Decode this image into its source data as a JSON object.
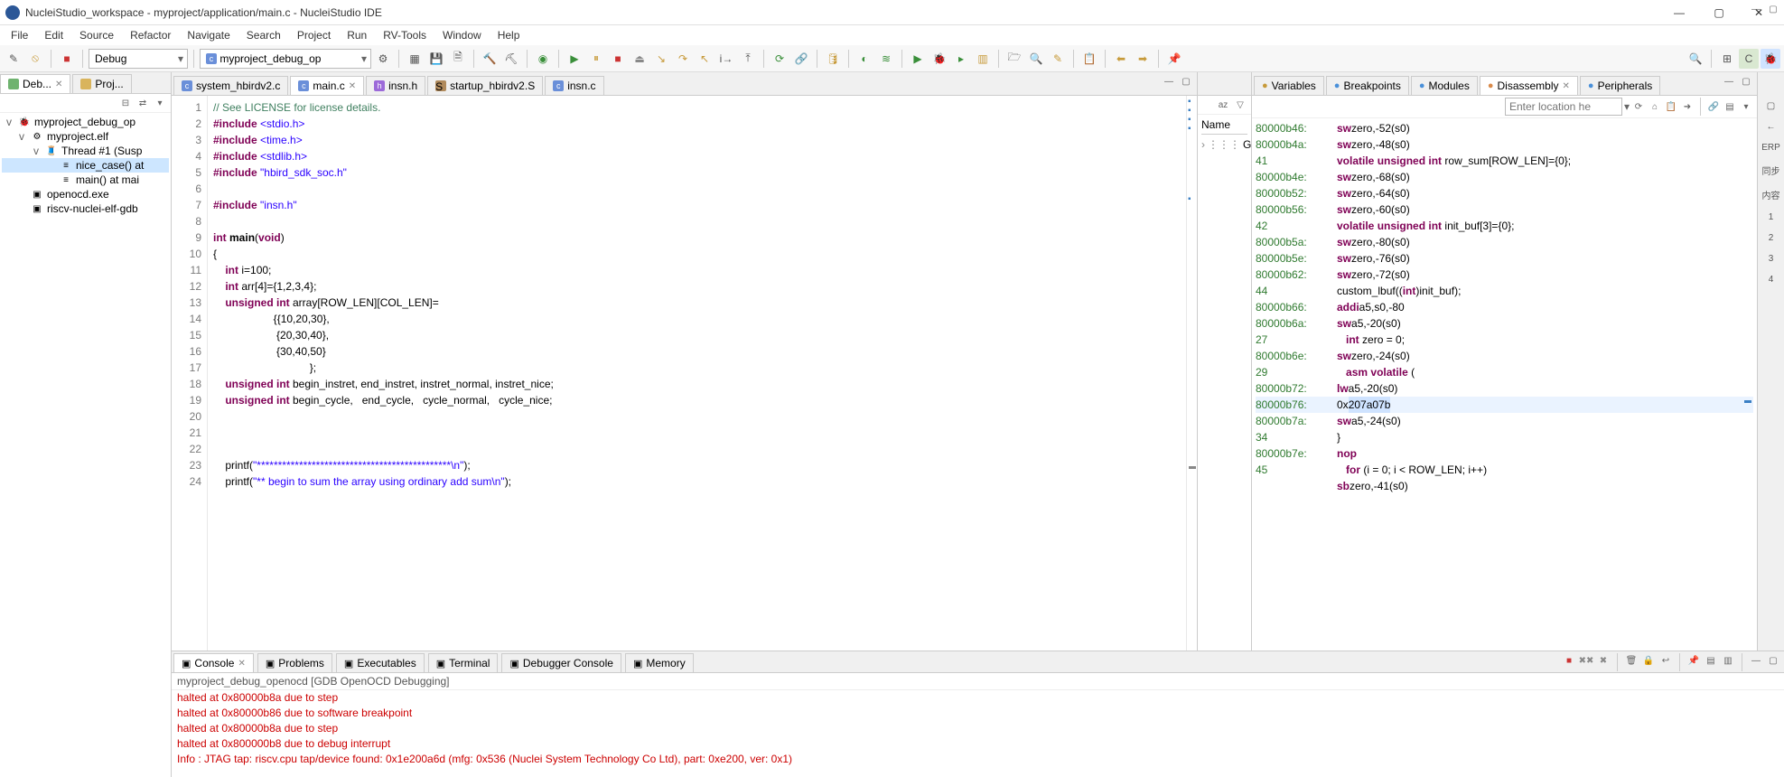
{
  "title": "NucleiStudio_workspace - myproject/application/main.c - NucleiStudio IDE",
  "menus": [
    "File",
    "Edit",
    "Source",
    "Refactor",
    "Navigate",
    "Search",
    "Project",
    "Run",
    "RV-Tools",
    "Window",
    "Help"
  ],
  "toolbar": {
    "config": "Debug",
    "launch": "myproject_debug_op"
  },
  "left": {
    "tabs": [
      {
        "label": "Deb...",
        "active": true
      },
      {
        "label": "Proj...",
        "active": false
      }
    ],
    "tree": [
      {
        "label": "myproject_debug_op",
        "depth": 0,
        "exp": "v",
        "icon": "🐞"
      },
      {
        "label": "myproject.elf",
        "depth": 1,
        "exp": "v",
        "icon": "⚙"
      },
      {
        "label": "Thread #1 (Susp",
        "depth": 2,
        "exp": "v",
        "icon": "🧵"
      },
      {
        "label": "nice_case() at",
        "depth": 3,
        "icon": "≡",
        "sel": true
      },
      {
        "label": "main() at mai",
        "depth": 3,
        "icon": "≡"
      },
      {
        "label": "openocd.exe",
        "depth": 1,
        "icon": "▣"
      },
      {
        "label": "riscv-nuclei-elf-gdb",
        "depth": 1,
        "icon": "▣"
      }
    ]
  },
  "editor": {
    "tabs": [
      {
        "label": "system_hbirdv2.c",
        "type": "c"
      },
      {
        "label": "main.c",
        "type": "c",
        "active": true
      },
      {
        "label": "insn.h",
        "type": "h"
      },
      {
        "label": "startup_hbirdv2.S",
        "type": "s"
      },
      {
        "label": "insn.c",
        "type": "c"
      }
    ],
    "lines": [
      {
        "n": 1,
        "html": "<span class='c-comment'>// See LICENSE for license details.</span>"
      },
      {
        "n": 2,
        "html": "<span class='c-pp'>#include</span> <span class='c-ppinc'>&lt;stdio.h&gt;</span>"
      },
      {
        "n": 3,
        "html": "<span class='c-pp'>#include</span> <span class='c-ppinc'>&lt;time.h&gt;</span>"
      },
      {
        "n": 4,
        "html": "<span class='c-pp'>#include</span> <span class='c-ppinc'>&lt;stdlib.h&gt;</span>"
      },
      {
        "n": 5,
        "html": "<span class='c-pp'>#include</span> <span class='c-ppinc'>\"hbird_sdk_soc.h\"</span>"
      },
      {
        "n": 6,
        "html": ""
      },
      {
        "n": 7,
        "html": "<span class='c-pp'>#include</span> <span class='c-ppinc'>\"insn.h\"</span>"
      },
      {
        "n": 8,
        "html": ""
      },
      {
        "n": 9,
        "html": "<span class='c-kw'>int</span> <b>main</b>(<span class='c-kw'>void</span>)"
      },
      {
        "n": 10,
        "html": "{"
      },
      {
        "n": 11,
        "html": "    <span class='c-kw'>int</span> i=100;"
      },
      {
        "n": 12,
        "html": "    <span class='c-kw'>int</span> arr[4]={1,2,3,4};"
      },
      {
        "n": 13,
        "html": "    <span class='c-kw'>unsigned int</span> array[ROW_LEN][COL_LEN]="
      },
      {
        "n": 14,
        "html": "                    {{10,20,30},"
      },
      {
        "n": 15,
        "html": "                     {20,30,40},"
      },
      {
        "n": 16,
        "html": "                     {30,40,50}"
      },
      {
        "n": 17,
        "html": "                                };"
      },
      {
        "n": 18,
        "html": "    <span class='c-kw'>unsigned int</span> begin_instret, end_instret, instret_normal, instret_nice;"
      },
      {
        "n": 19,
        "html": "    <span class='c-kw'>unsigned int</span> begin_cycle,   end_cycle,   cycle_normal,   cycle_nice;"
      },
      {
        "n": 20,
        "html": ""
      },
      {
        "n": 21,
        "html": ""
      },
      {
        "n": 22,
        "html": ""
      },
      {
        "n": 23,
        "html": "    printf(<span class='c-str'>\"**********************************************\\n\"</span>);"
      },
      {
        "n": 24,
        "html": "    printf(<span class='c-str'>\"** begin to sum the array using ordinary add sum\\n\"</span>);"
      }
    ]
  },
  "outline": {
    "header": "Name",
    "item": "Gen"
  },
  "right": {
    "tabs": [
      {
        "label": "Variables",
        "icon": "ic-vars"
      },
      {
        "label": "Breakpoints",
        "icon": "ic-bp"
      },
      {
        "label": "Modules",
        "icon": "ic-mod"
      },
      {
        "label": "Disassembly",
        "icon": "ic-dis",
        "active": true
      },
      {
        "label": "Peripherals",
        "icon": "ic-per"
      }
    ],
    "loc_placeholder": "Enter location he",
    "disasm": [
      {
        "addr": "80000b46:",
        "op": "sw",
        "args": "zero,-52(s0)"
      },
      {
        "addr": "80000b4a:",
        "op": "sw",
        "args": "zero,-48(s0)"
      },
      {
        "addr": "41",
        "src": "volatile unsigned int row_sum[ROW_LEN]={0};"
      },
      {
        "addr": "80000b4e:",
        "op": "sw",
        "args": "zero,-68(s0)"
      },
      {
        "addr": "80000b52:",
        "op": "sw",
        "args": "zero,-64(s0)"
      },
      {
        "addr": "80000b56:",
        "op": "sw",
        "args": "zero,-60(s0)"
      },
      {
        "addr": "42",
        "src": "volatile unsigned int init_buf[3]={0};"
      },
      {
        "addr": "80000b5a:",
        "op": "sw",
        "args": "zero,-80(s0)"
      },
      {
        "addr": "80000b5e:",
        "op": "sw",
        "args": "zero,-76(s0)"
      },
      {
        "addr": "80000b62:",
        "op": "sw",
        "args": "zero,-72(s0)"
      },
      {
        "addr": "44",
        "src": "custom_lbuf((int)init_buf);"
      },
      {
        "addr": "80000b66:",
        "op": "addi",
        "args": "a5,s0,-80"
      },
      {
        "addr": "80000b6a:",
        "op": "sw",
        "args": "a5,-20(s0)"
      },
      {
        "addr": "27",
        "src": "   int zero = 0;"
      },
      {
        "addr": "80000b6e:",
        "op": "sw",
        "args": "zero,-24(s0)"
      },
      {
        "addr": "29",
        "src": "   asm volatile ("
      },
      {
        "addr": "80000b72:",
        "op": "lw",
        "args": "a5,-20(s0)"
      },
      {
        "addr": "80000b76:",
        "hex": "0x",
        "hl": "207a07b",
        "cur": true
      },
      {
        "addr": "80000b7a:",
        "op": "sw",
        "args": "a5,-24(s0)"
      },
      {
        "addr": "34",
        "src": "}"
      },
      {
        "addr": "80000b7e:",
        "op": "nop",
        "args": ""
      },
      {
        "addr": "45",
        "src": "   for (i = 0; i < ROW_LEN; i++)"
      },
      {
        "addr": "",
        "op": "sb",
        "args": "zero,-41(s0)"
      }
    ]
  },
  "console": {
    "tabs": [
      {
        "label": "Console",
        "active": true
      },
      {
        "label": "Problems"
      },
      {
        "label": "Executables"
      },
      {
        "label": "Terminal"
      },
      {
        "label": "Debugger Console"
      },
      {
        "label": "Memory"
      }
    ],
    "title": "myproject_debug_openocd [GDB OpenOCD Debugging]",
    "lines": [
      "halted at 0x80000b8a due to step",
      "halted at 0x80000b86 due to software breakpoint",
      "halted at 0x80000b8a due to step",
      "halted at 0x800000b8 due to debug interrupt",
      "Info : JTAG tap: riscv.cpu tap/device found: 0x1e200a6d (mfg: 0x536 (Nuclei System Technology Co Ltd), part: 0xe200, ver: 0x1)"
    ]
  },
  "sidebar": [
    "ERP",
    "同步",
    "内容",
    "1",
    "2",
    "3",
    "4"
  ]
}
